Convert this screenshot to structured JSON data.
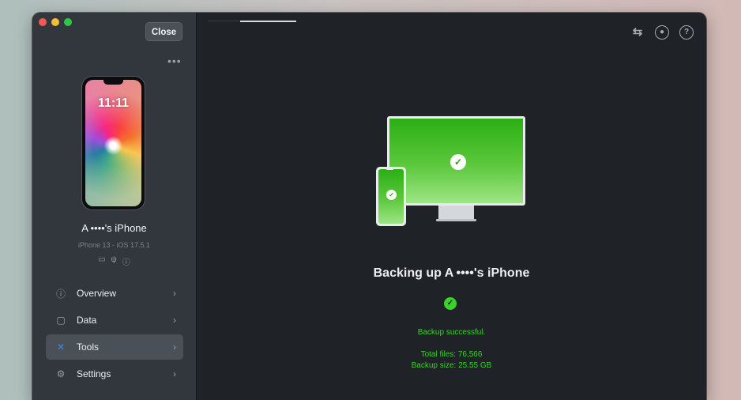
{
  "window": {
    "close_label": "Close",
    "more_icon": "more-icon"
  },
  "device": {
    "time": "11:11",
    "name": "A ••••'s iPhone",
    "subtitle": "iPhone 13 - iOS 17.5.1",
    "status_icons": [
      "battery-icon",
      "usb-icon",
      "info-icon"
    ]
  },
  "nav": {
    "items": [
      {
        "label": "Overview",
        "icon": "info-icon",
        "active": false
      },
      {
        "label": "Data",
        "icon": "square-icon",
        "active": false
      },
      {
        "label": "Tools",
        "icon": "tools-icon",
        "active": true
      },
      {
        "label": "Settings",
        "icon": "gear-icon",
        "active": false
      }
    ]
  },
  "toolbar": {
    "icons": [
      "transfer-icon",
      "account-icon",
      "help-icon"
    ]
  },
  "backup": {
    "title": "Backing up A ••••'s iPhone",
    "status": "Backup successful.",
    "total_files": "Total files: 76,566",
    "backup_size": "Backup size: 25.55 GB"
  },
  "colors": {
    "accent": "#2f8cf3",
    "success": "#39d32a",
    "success_text": "#3ad02a"
  }
}
